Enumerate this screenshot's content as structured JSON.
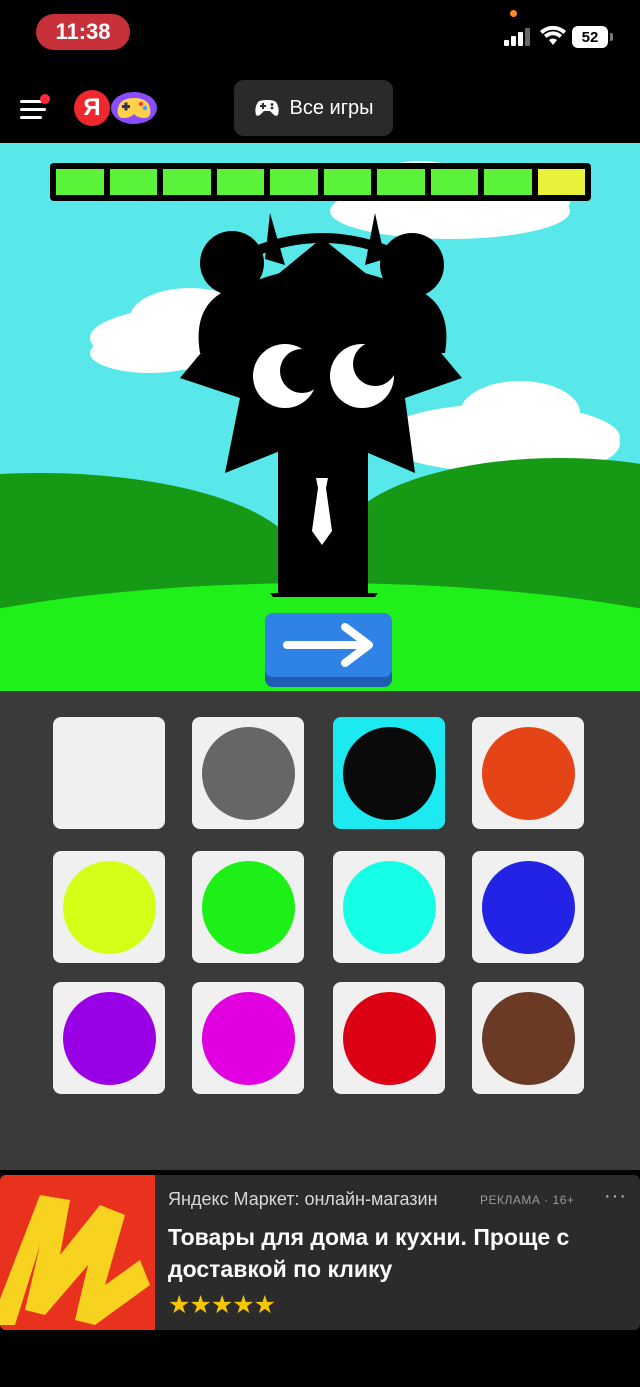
{
  "status_bar": {
    "time": "11:38",
    "battery": "52",
    "icons": [
      "cellular-signal-icon",
      "wifi-icon",
      "battery-icon"
    ]
  },
  "app_bar": {
    "menu_icon": "hamburger-menu-icon",
    "logo_letter": "Я",
    "games_icon": "gamepad-logo-icon",
    "all_games_label": "Все игры",
    "all_games_icon": "gamepad-icon"
  },
  "game": {
    "progress": {
      "total_segments": 10,
      "filled_segments": 9,
      "current_segment": 10
    },
    "colors": {
      "sky": "#58e8ea",
      "grass": "#1ff01a",
      "hill": "#169a16",
      "segment_done": "#5bf23a",
      "segment_current": "#e8f23a",
      "character": "#000000"
    },
    "next_button_icon": "arrow-right-icon"
  },
  "palette": {
    "selected_index": 2,
    "swatches": [
      {
        "name": "white",
        "color": "#f0f0f0"
      },
      {
        "name": "gray",
        "color": "#666666"
      },
      {
        "name": "black",
        "color": "#0a0a0a"
      },
      {
        "name": "orange",
        "color": "#e54516"
      },
      {
        "name": "yellow",
        "color": "#d4ff16"
      },
      {
        "name": "green",
        "color": "#1cf016"
      },
      {
        "name": "cyan",
        "color": "#16ffe6"
      },
      {
        "name": "blue",
        "color": "#2323e6"
      },
      {
        "name": "purple",
        "color": "#9a00e6"
      },
      {
        "name": "magenta",
        "color": "#e000e0"
      },
      {
        "name": "red",
        "color": "#dc0014"
      },
      {
        "name": "brown",
        "color": "#6a3a24"
      }
    ]
  },
  "ad": {
    "source": "Яндекс Маркет: онлайн-магазин",
    "tag": "РЕКЛАМА · 16+",
    "more": "···",
    "title": "Товары для дома и кухни. Проще с доставкой по клику",
    "rating_stars": "★★★★★",
    "rating": 5
  }
}
